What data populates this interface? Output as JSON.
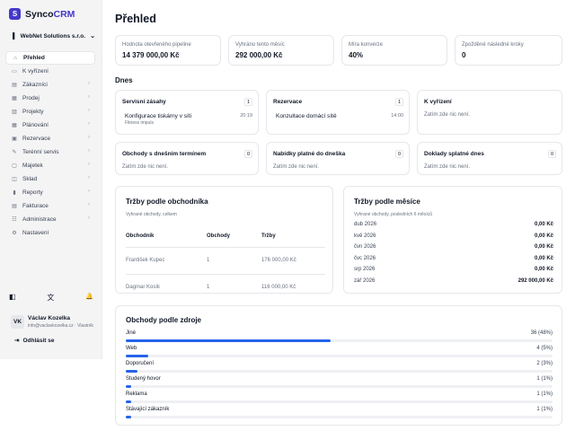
{
  "brand": {
    "prefix": "Synco",
    "accent": "CRM",
    "badge": "S",
    "color": "#4338ca"
  },
  "company": {
    "name": "WebNet Solutions s.r.o."
  },
  "nav": [
    {
      "label": "Přehled",
      "icon": "home-icon",
      "glyph": "⌂",
      "active": true,
      "arrow": false
    },
    {
      "label": "K vyřízení",
      "icon": "inbox-icon",
      "glyph": "▭",
      "active": false,
      "arrow": false
    },
    {
      "label": "Zákazníci",
      "icon": "users-icon",
      "glyph": "▤",
      "active": false,
      "arrow": true
    },
    {
      "label": "Prodej",
      "icon": "cart-icon",
      "glyph": "▦",
      "active": false,
      "arrow": true
    },
    {
      "label": "Projekty",
      "icon": "folder-icon",
      "glyph": "▥",
      "active": false,
      "arrow": true
    },
    {
      "label": "Plánování",
      "icon": "calendar-icon",
      "glyph": "▦",
      "active": false,
      "arrow": true
    },
    {
      "label": "Rezervace",
      "icon": "booking-icon",
      "glyph": "▣",
      "active": false,
      "arrow": true
    },
    {
      "label": "Terénní servis",
      "icon": "wrench-icon",
      "glyph": "✎",
      "active": false,
      "arrow": true
    },
    {
      "label": "Majetek",
      "icon": "asset-icon",
      "glyph": "▢",
      "active": false,
      "arrow": true
    },
    {
      "label": "Sklad",
      "icon": "warehouse-icon",
      "glyph": "◫",
      "active": false,
      "arrow": true
    },
    {
      "label": "Reporty",
      "icon": "chart-icon",
      "glyph": "▮",
      "active": false,
      "arrow": true
    },
    {
      "label": "Fakturace",
      "icon": "invoice-icon",
      "glyph": "▤",
      "active": false,
      "arrow": true
    },
    {
      "label": "Administrace",
      "icon": "admin-icon",
      "glyph": "☷",
      "active": false,
      "arrow": true
    },
    {
      "label": "Nastavení",
      "icon": "gear-icon",
      "glyph": "⚙",
      "active": false,
      "arrow": false
    }
  ],
  "tools": {
    "theme_glyph": "◧",
    "lang_glyph": "文",
    "bell_glyph": "🔔"
  },
  "user": {
    "initials": "VK",
    "name": "Václav Kozelka",
    "email": "info@vaclavkozelka.cz · Vlastník"
  },
  "logout": {
    "label": "Odhlásit se",
    "glyph": "⇥"
  },
  "page": {
    "title": "Přehled"
  },
  "kpis": [
    {
      "label": "Hodnota otevřeného pipeline",
      "value": "14 379 000,00 Kč"
    },
    {
      "label": "Vyhráno tento měsíc",
      "value": "292 000,00 Kč"
    },
    {
      "label": "Míra konverze",
      "value": "40%"
    },
    {
      "label": "Zpožděné následné kroky",
      "value": "0"
    }
  ],
  "today": {
    "label": "Dnes",
    "tiles": [
      {
        "title": "Servisní zásahy",
        "count": "1",
        "empty": "",
        "events": [
          {
            "title": "Konfigurace tiskárny v síti",
            "time": "20:19",
            "sub": "Fitness impuls"
          }
        ]
      },
      {
        "title": "Rezervace",
        "count": "1",
        "empty": "",
        "events": [
          {
            "title": "Konzultace domácí sítě",
            "time": "14:00",
            "sub": ""
          }
        ]
      },
      {
        "title": "K vyřízení",
        "count": "",
        "empty": "Zatím zde nic není.",
        "events": []
      },
      {
        "title": "Obchody s dnešním termínem",
        "count": "0",
        "empty": "Zatím zde nic není.",
        "events": []
      },
      {
        "title": "Nabídky platné do dneška",
        "count": "0",
        "empty": "Zatím zde nic není.",
        "events": []
      },
      {
        "title": "Doklady splatné dnes",
        "count": "0",
        "empty": "Zatím zde nic není.",
        "events": []
      }
    ]
  },
  "sales_by_rep": {
    "title": "Tržby podle obchodníka",
    "subtitle": "Vyhrané obchody, celkem",
    "columns": [
      "Obchodník",
      "Obchody",
      "Tržby"
    ],
    "rows": [
      [
        "František Kupec",
        "1",
        "176 000,00 Kč"
      ],
      [
        "Dagmar Kosík",
        "1",
        "116 000,00 Kč"
      ]
    ]
  },
  "sales_by_month": {
    "title": "Tržby podle měsíce",
    "subtitle": "Vyhrané obchody, posledních 6 měsíců",
    "rows": [
      {
        "month": "dub 2026",
        "value": "0,00 Kč"
      },
      {
        "month": "kvě 2026",
        "value": "0,00 Kč"
      },
      {
        "month": "čvn 2026",
        "value": "0,00 Kč"
      },
      {
        "month": "čvc 2026",
        "value": "0,00 Kč"
      },
      {
        "month": "srp 2026",
        "value": "0,00 Kč"
      },
      {
        "month": "zář 2026",
        "value": "292 000,00 Kč"
      }
    ]
  },
  "deal_sources": {
    "title": "Obchody podle zdroje",
    "bar_color": "#2563eb",
    "rows": [
      {
        "name": "Jiné",
        "label": "36 (48%)",
        "share": 0.48
      },
      {
        "name": "Web",
        "label": "4 (5%)",
        "share": 0.053
      },
      {
        "name": "Doporučení",
        "label": "2 (3%)",
        "share": 0.027
      },
      {
        "name": "Studený hovor",
        "label": "1 (1%)",
        "share": 0.013
      },
      {
        "name": "Reklama",
        "label": "1 (1%)",
        "share": 0.013
      },
      {
        "name": "Stávající zákazník",
        "label": "1 (1%)",
        "share": 0.013
      }
    ]
  }
}
